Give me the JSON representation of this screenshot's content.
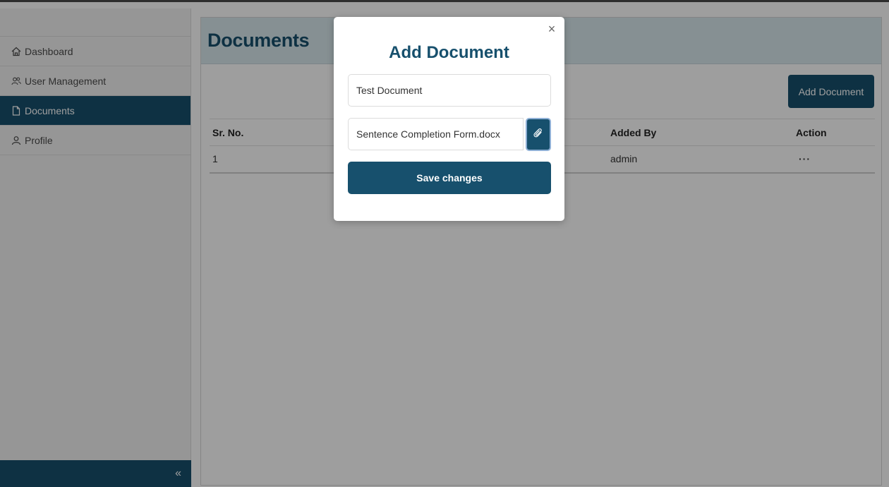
{
  "sidebar": {
    "items": [
      {
        "label": "Dashboard",
        "icon": "home-icon"
      },
      {
        "label": "User Management",
        "icon": "users-icon"
      },
      {
        "label": "Documents",
        "icon": "document-icon"
      },
      {
        "label": "Profile",
        "icon": "person-icon"
      }
    ],
    "active_item": "Documents",
    "collapse_label": "«"
  },
  "page": {
    "title": "Documents",
    "add_button_label": "Add Document"
  },
  "table": {
    "headers": [
      "Sr. No.",
      "Added By",
      "Action"
    ],
    "rows": [
      {
        "sr_no": "1",
        "added_by": "admin",
        "action": "···"
      }
    ]
  },
  "modal": {
    "title": "Add Document",
    "close_label": "×",
    "name_value": "Test Document",
    "file_value": "Sentence Completion Form.docx",
    "save_label": "Save changes"
  },
  "colors": {
    "primary": "#17506d",
    "header_bg": "#d8e8ee",
    "overlay": "rgba(0,0,0,0.38)"
  }
}
